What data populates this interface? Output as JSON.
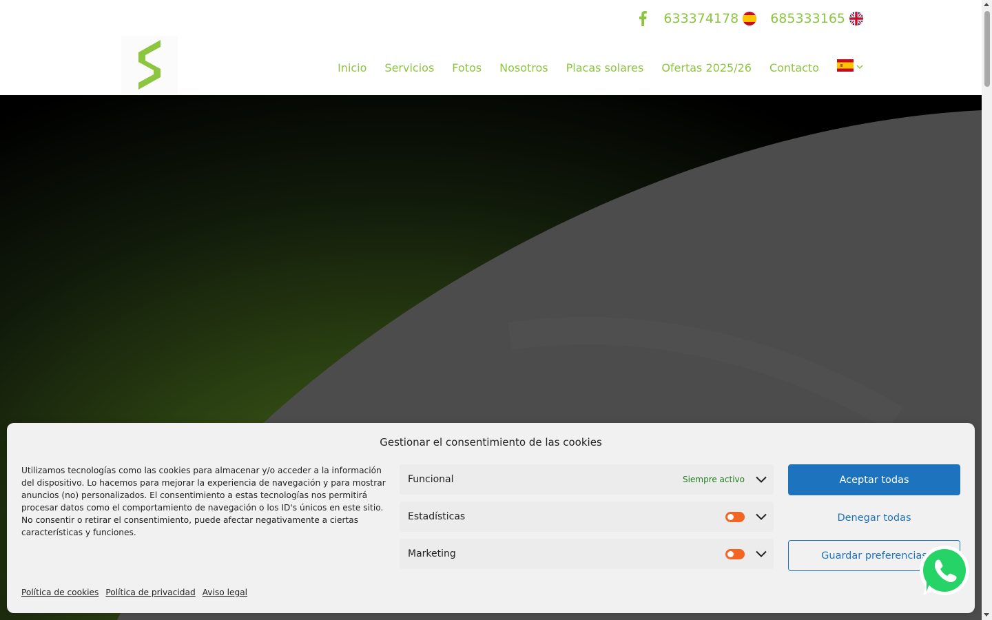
{
  "header": {
    "phones": [
      {
        "number": "633374178",
        "flag": "spain-flag-icon"
      },
      {
        "number": "685333165",
        "flag": "uk-flag-icon"
      }
    ],
    "social_icon": "facebook-icon",
    "logo_icon": "company-logo-s-icon",
    "nav": [
      {
        "label": "Inicio"
      },
      {
        "label": "Servicios"
      },
      {
        "label": "Fotos"
      },
      {
        "label": "Nosotros"
      },
      {
        "label": "Placas solares"
      },
      {
        "label": "Ofertas 2025/26"
      },
      {
        "label": "Contacto"
      }
    ],
    "language_icon": "spain-flag-icon"
  },
  "cookie_banner": {
    "title": "Gestionar el consentimiento de las cookies",
    "description": "Utilizamos tecnologías como las cookies para almacenar y/o acceder a la información del dispositivo. Lo hacemos para mejorar la experiencia de navegación y para mostrar anuncios (no) personalizados. El consentimiento a estas tecnologías nos permitirá procesar datos como el comportamiento de navegación o los ID's únicos en este sitio. No consentir o retirar el consentimiento, puede afectar negativamente a ciertas características y funciones.",
    "categories": [
      {
        "label": "Funcional",
        "status": "Siempre activo"
      },
      {
        "label": "Estadísticas",
        "status": ""
      },
      {
        "label": "Marketing",
        "status": ""
      }
    ],
    "buttons": {
      "accept": "Aceptar todas",
      "deny": "Denegar todas",
      "save": "Guardar preferencias"
    },
    "links": [
      "Política de cookies",
      "Política de privacidad",
      "Aviso legal"
    ]
  },
  "colors": {
    "brand_green": "#8cc63f",
    "accept_blue": "#1e73be",
    "toggle_orange": "#f26522",
    "whatsapp_green": "#25d366"
  },
  "floating": {
    "whatsapp_icon": "whatsapp-icon"
  }
}
